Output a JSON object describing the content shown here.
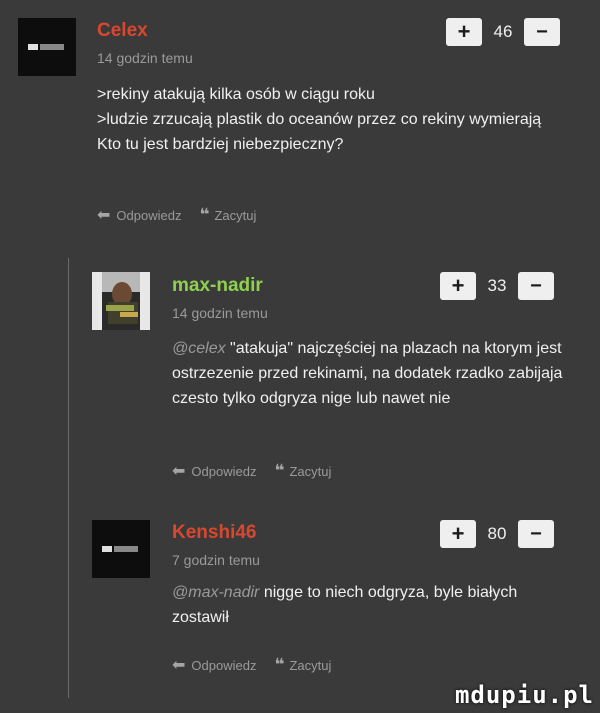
{
  "actions": {
    "reply_label": "Odpowiedz",
    "quote_label": "Zacytuj"
  },
  "vote": {
    "plus": "+",
    "minus": "−"
  },
  "comments": [
    {
      "username": "Celex",
      "time": "14 godzin temu",
      "score": "46",
      "mention": "",
      "text": ">rekiny atakują kilka osób w ciągu roku\n>ludzie zrzucają plastik do oceanów przez co rekiny wymierają\nKto tu jest bardziej niebezpieczny?"
    },
    {
      "username": "max-nadir",
      "time": "14 godzin temu",
      "score": "33",
      "mention": "@celex",
      "text": " \"atakuja\" najczęściej na plazach na ktorym jest ostrzezenie przed rekinami, na dodatek rzadko zabijaja czesto tylko odgryza nige lub nawet nie"
    },
    {
      "username": "Kenshi46",
      "time": "7 godzin temu",
      "score": "80",
      "mention": "@max-nadir",
      "text": " nigge to niech odgryza, byle białych zostawił"
    }
  ],
  "watermark": "mdupiu.pl",
  "colors": {
    "background": "#3a3a3a",
    "red_user": "#d9472e",
    "green_user": "#8fd14f",
    "muted": "#9a9a9a"
  }
}
